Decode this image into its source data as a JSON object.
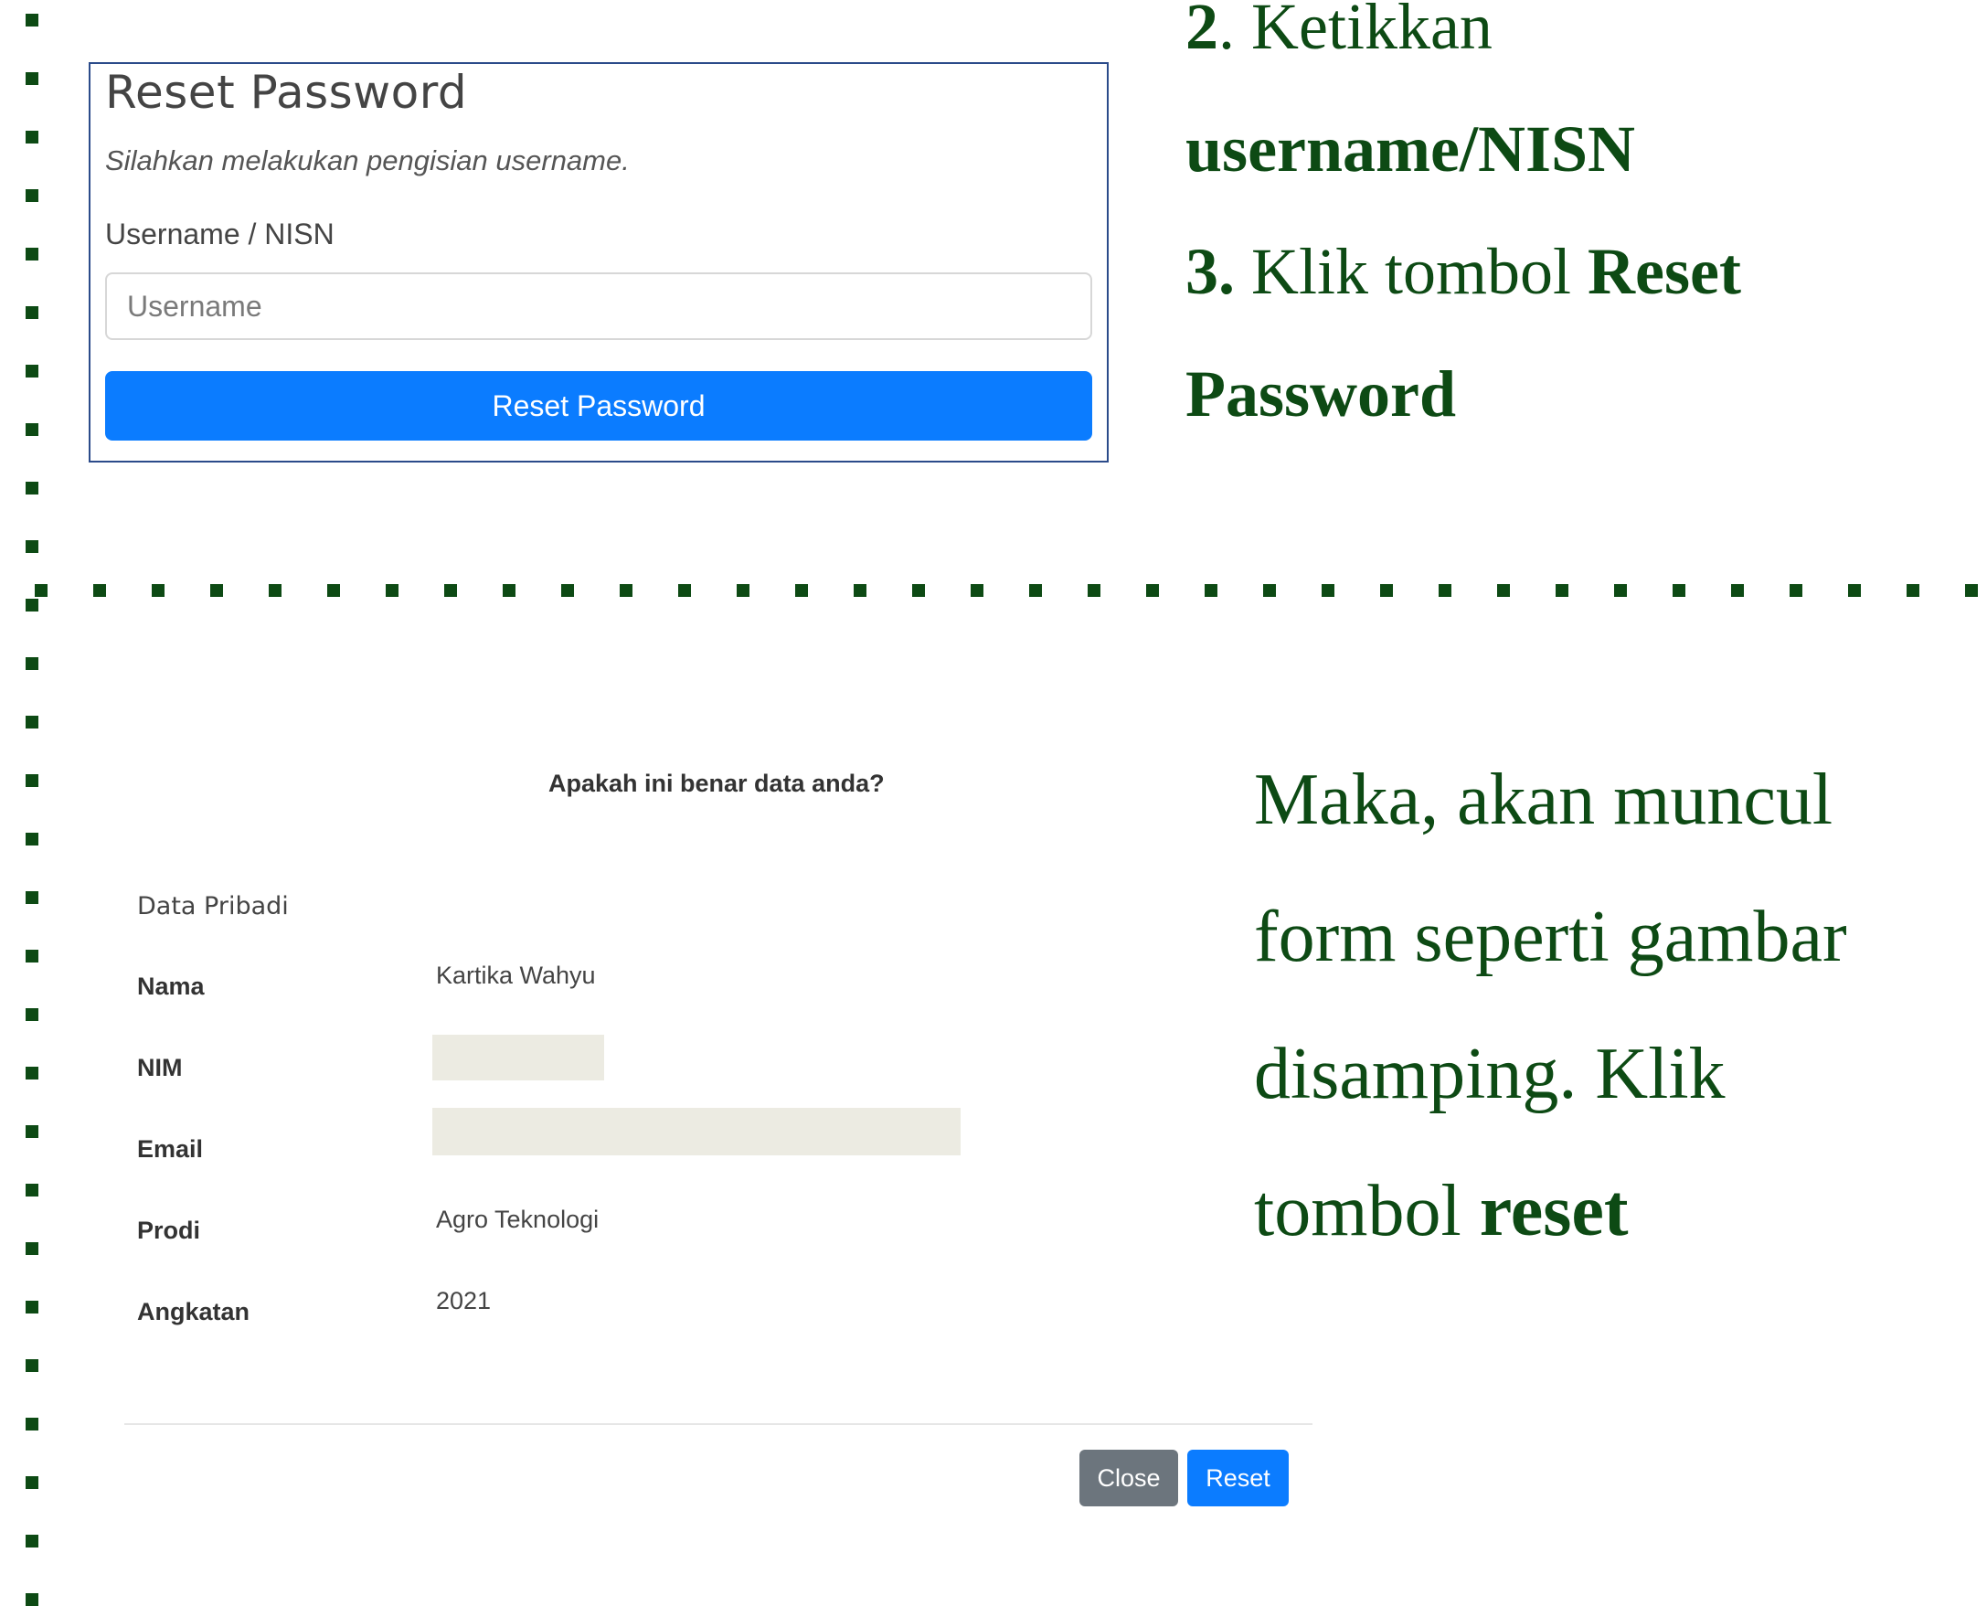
{
  "reset_panel": {
    "title": "Reset Password",
    "subtitle": "Silahkan melakukan pengisian username.",
    "field_label": "Username / NISN",
    "input_placeholder": "Username",
    "input_value": "",
    "button_label": "Reset Password"
  },
  "steps": {
    "step2_number": "2",
    "step2_text": ". Ketikkan",
    "step2_bold": "username/NISN",
    "step3_number": "3.",
    "step3_text": " Klik tombol ",
    "step3_bold1": "Reset",
    "step3_bold2": "Password"
  },
  "note": {
    "line1": "Maka, akan muncul",
    "line2": "form seperti gambar",
    "line3": "disamping. Klik",
    "line4_prefix": "tombol ",
    "line4_bold": "reset"
  },
  "dialog": {
    "question": "Apakah ini benar data anda?",
    "section_label": "Data Pribadi",
    "fields": [
      {
        "label": "Nama",
        "value": "Kartika Wahyu"
      },
      {
        "label": "NIM",
        "value": ""
      },
      {
        "label": "Email",
        "value": ""
      },
      {
        "label": "Prodi",
        "value": "Agro Teknologi"
      },
      {
        "label": "Angkatan",
        "value": "2021"
      }
    ],
    "close_label": "Close",
    "reset_label": "Reset"
  },
  "colors": {
    "accent_green": "#0d4a14",
    "primary_blue": "#0b7cff",
    "secondary_gray": "#6c757d"
  }
}
